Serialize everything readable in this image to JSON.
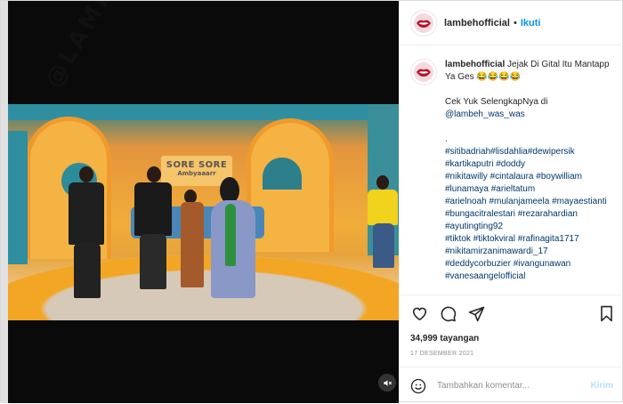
{
  "header": {
    "username": "lambehofficial",
    "separator": "•",
    "follow_label": "Ikuti"
  },
  "video": {
    "sign_line1": "SORE SORE",
    "sign_line2": "Ambyaaarr",
    "watermark": "@LAMBEH_@SE",
    "mute_icon": "speaker-muted-icon"
  },
  "caption": {
    "username": "lambehofficial",
    "title": "Jejak Di Gital Itu Mantapp Ya Ges 😂😂😂😂",
    "line_cek": "Cek Yuk SelengkapNya di",
    "mention": "@lambeh_was_was",
    "dot": ".",
    "hashtags": [
      "#sitibadriah#lisdahlia#dewipersik",
      "#kartikaputri #doddy",
      "#nikitawilly #cintalaura #boywilliam",
      "#lunamaya #arieltatum",
      "#arielnoah #mulanjameela #mayaestianti",
      "#bungacitralestari #rezarahardian",
      "#ayutingting92",
      "#tiktok #tiktokviral #rafinagita1717",
      "#nikitamirzanimawardi_17",
      "#deddycorbuzier #ivangunawan",
      "#vanesaangelofficial"
    ]
  },
  "actions": {
    "views": "34,999 tayangan",
    "date": "17 DESEMBER 2021",
    "icons": [
      "heart-icon",
      "comment-icon",
      "share-icon",
      "bookmark-icon"
    ]
  },
  "comment": {
    "placeholder": "Tambahkan komentar...",
    "post_label": "Kirim"
  },
  "colors": {
    "link_blue": "#0095f6",
    "mention_blue": "#00376b",
    "brand_red": "#b5122b"
  }
}
